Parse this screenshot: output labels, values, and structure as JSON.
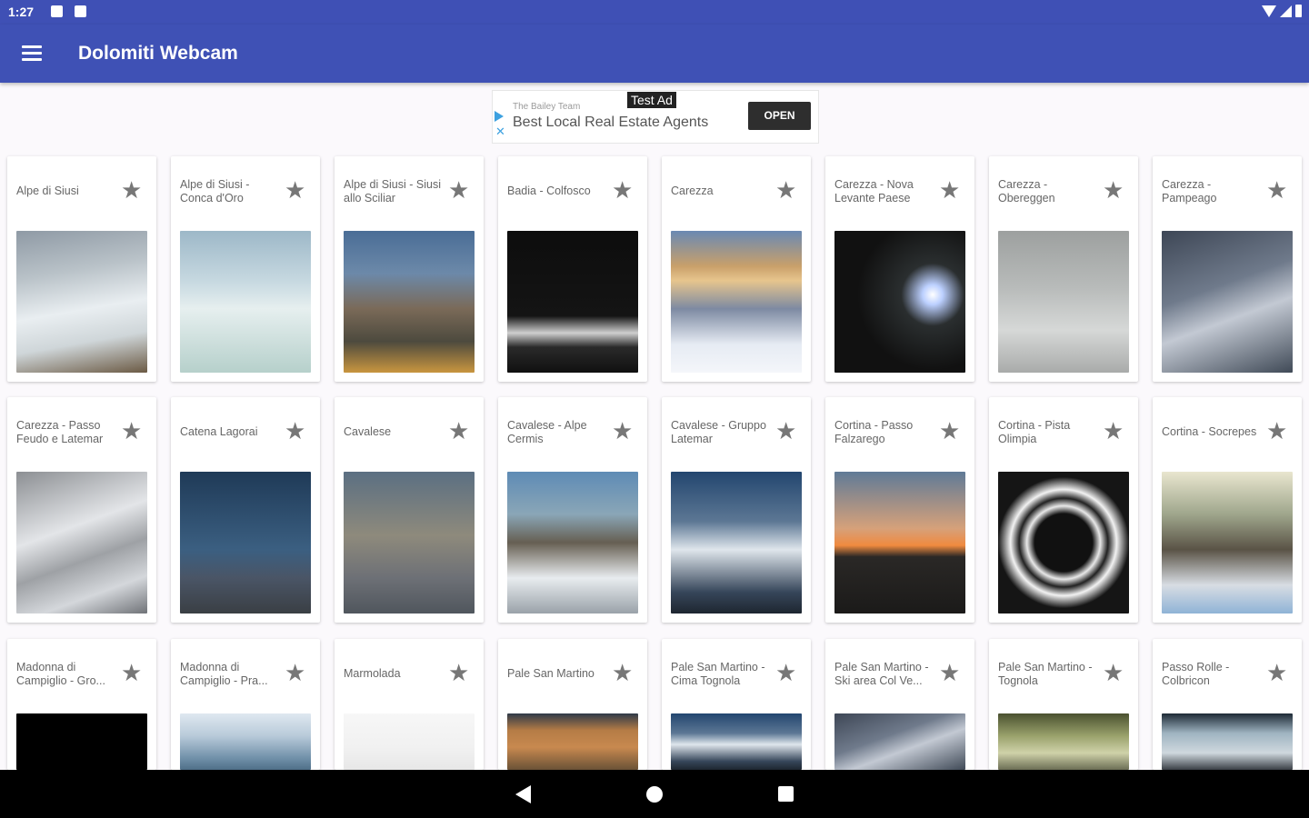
{
  "status_bar": {
    "time": "1:27"
  },
  "app_bar": {
    "title": "Dolomiti Webcam"
  },
  "ad": {
    "badge": "Test Ad",
    "sponsor": "The Bailey Team",
    "headline": "Best Local Real Estate Agents",
    "cta": "OPEN"
  },
  "colors": {
    "primary": "#3f51b5",
    "status_bar": "#3f50b5",
    "background": "#fbf9fc"
  },
  "webcams": [
    {
      "name": "Alpe di Siusi",
      "icon": "star-icon",
      "thumb": "snowy-slope"
    },
    {
      "name": "Alpe di Siusi - Conca d'Oro",
      "icon": "star-icon",
      "thumb": "snowy-mountain-sky"
    },
    {
      "name": "Alpe di Siusi - Siusi allo Sciliar",
      "icon": "star-icon",
      "thumb": "rocky-peak-village"
    },
    {
      "name": "Badia - Colfosco",
      "icon": "star-icon",
      "thumb": "night-lights"
    },
    {
      "name": "Carezza",
      "icon": "star-icon",
      "thumb": "sunlit-peaks"
    },
    {
      "name": "Carezza - Nova Levante Paese",
      "icon": "star-icon",
      "thumb": "night-bright-light"
    },
    {
      "name": "Carezza - Obereggen",
      "icon": "star-icon",
      "thumb": "foggy-slope"
    },
    {
      "name": "Carezza - Pampeago",
      "icon": "star-icon",
      "thumb": "snowy-forest"
    },
    {
      "name": "Carezza - Passo Feudo e Latemar",
      "icon": "star-icon",
      "thumb": "rocky-snow"
    },
    {
      "name": "Catena Lagorai",
      "icon": "star-icon",
      "thumb": "blue-dusk-valley"
    },
    {
      "name": "Cavalese",
      "icon": "star-icon",
      "thumb": "town-aerial"
    },
    {
      "name": "Cavalese - Alpe Cermis",
      "icon": "star-icon",
      "thumb": "ski-station"
    },
    {
      "name": "Cavalese - Gruppo Latemar",
      "icon": "star-icon",
      "thumb": "snowy-ridge"
    },
    {
      "name": "Cortina - Passo Falzarego",
      "icon": "star-icon",
      "thumb": "sunset-peak"
    },
    {
      "name": "Cortina - Pista Olimpia",
      "icon": "star-icon",
      "thumb": "stadium-lights"
    },
    {
      "name": "Cortina - Socrepes",
      "icon": "star-icon",
      "thumb": "ski-area-people"
    },
    {
      "name": "Madonna di Campiglio - Gro...",
      "icon": "star-icon",
      "thumb": "black"
    },
    {
      "name": "Madonna di Campiglio - Pra...",
      "icon": "star-icon",
      "thumb": "cloudy-mountains"
    },
    {
      "name": "Marmolada",
      "icon": "star-icon",
      "thumb": "white-fog"
    },
    {
      "name": "Pale San Martino",
      "icon": "star-icon",
      "thumb": "orange-peaks"
    },
    {
      "name": "Pale San Martino - Cima Tognola",
      "icon": "star-icon",
      "thumb": "snowy-ridge"
    },
    {
      "name": "Pale San Martino - Ski area Col Ve...",
      "icon": "star-icon",
      "thumb": "snowy-forest"
    },
    {
      "name": "Pale San Martino - Tognola",
      "icon": "star-icon",
      "thumb": "green-haze"
    },
    {
      "name": "Passo Rolle - Colbricon",
      "icon": "star-icon",
      "thumb": "peak-sky"
    }
  ],
  "nav": {
    "back": "back-icon",
    "home": "home-icon",
    "recents": "recents-icon"
  }
}
